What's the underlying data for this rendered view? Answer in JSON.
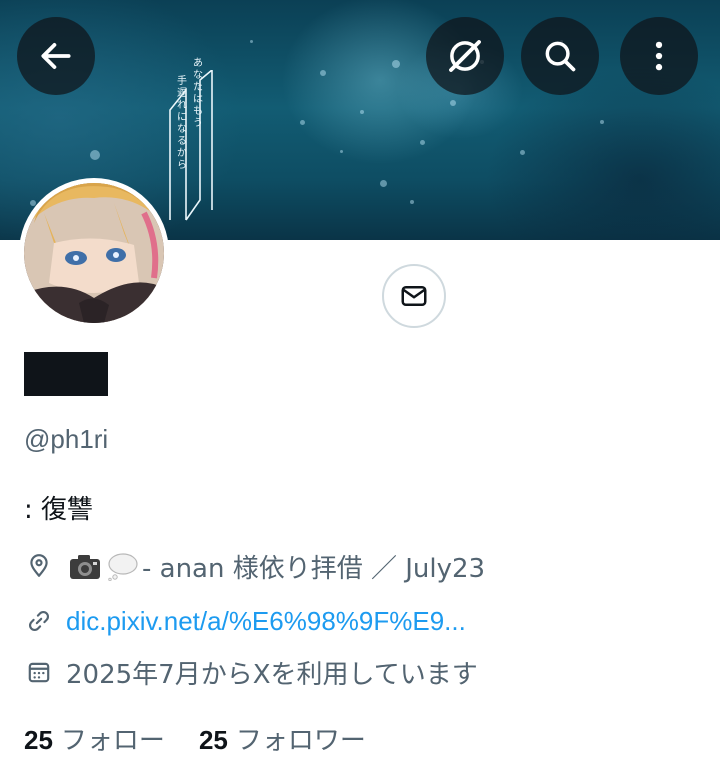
{
  "header": {
    "back_icon": "arrow-left-icon",
    "grok_icon": "grok-icon",
    "search_icon": "search-icon",
    "more_icon": "more-vertical-icon"
  },
  "banner": {
    "poem_lines": [
      "あなたはもう",
      "手遅れになるから"
    ]
  },
  "profile": {
    "handle": "@ph1ri",
    "bio": ": 復讐",
    "location_icon": "location-pin-icon",
    "location_text": "- anan 様依り拝借 ／ July23",
    "link_icon": "link-icon",
    "link_text": "dic.pixiv.net/a/%E6%98%9F%E9...",
    "joined_icon": "calendar-icon",
    "joined_text": "2025年7月からXを利用しています",
    "following_count": "25",
    "following_label": "フォロー",
    "followers_count": "25",
    "followers_label": "フォロワー"
  },
  "actions": {
    "message_icon": "mail-icon"
  },
  "colors": {
    "text_primary": "#0f1419",
    "text_secondary": "#536471",
    "link": "#1d9bf0",
    "border": "#cfd9de"
  }
}
